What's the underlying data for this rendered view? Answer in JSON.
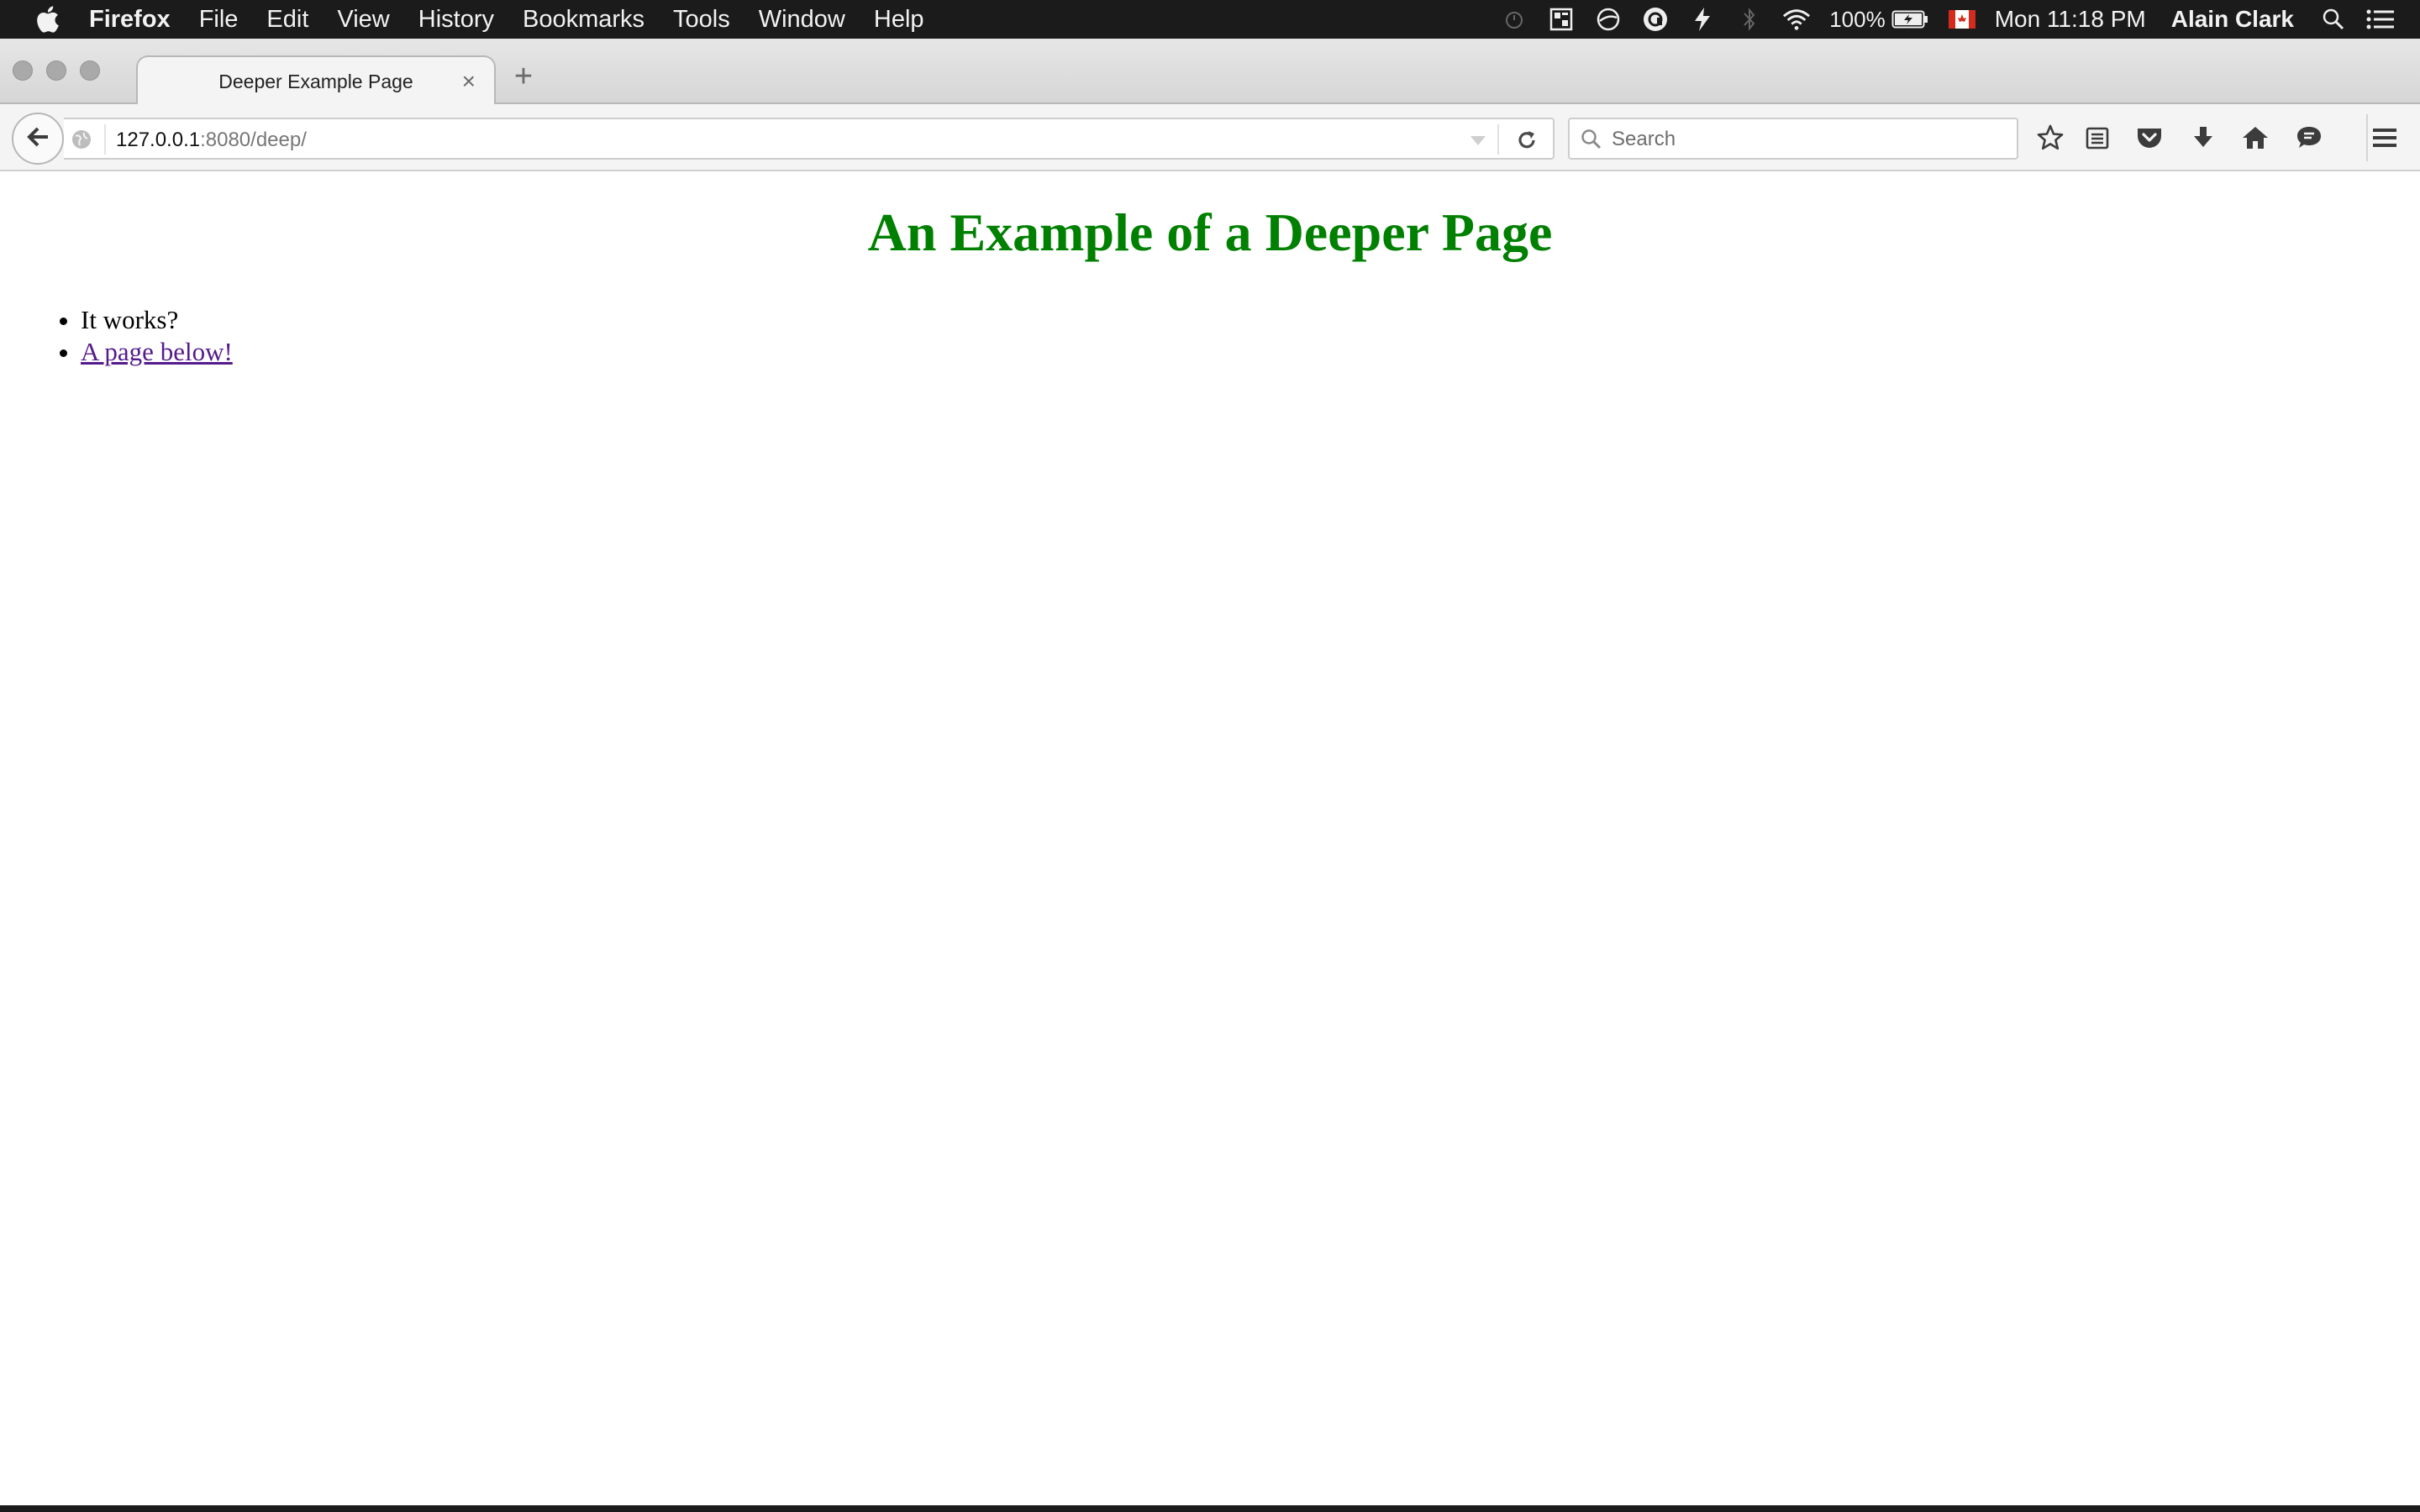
{
  "menubar": {
    "app_name": "Firefox",
    "items": [
      "File",
      "Edit",
      "View",
      "History",
      "Bookmarks",
      "Tools",
      "Window",
      "Help"
    ],
    "battery_percent": "100%",
    "clock": "Mon 11:18 PM",
    "user": "Alain Clark",
    "status_icons": [
      "timer-icon",
      "grid-app-icon",
      "circle-slash-icon",
      "grammarly-icon",
      "flash-app-icon",
      "bluetooth-icon",
      "wifi-icon",
      "battery-icon",
      "canada-flag-icon",
      "spotlight-search-icon",
      "notification-center-icon"
    ]
  },
  "tab": {
    "title": "Deeper Example Page"
  },
  "navbar": {
    "url_host": "127.0.0.1",
    "url_path": ":8080/deep/",
    "search_placeholder": "Search",
    "toolbar_icons": [
      "bookmark-star-icon",
      "reading-list-icon",
      "pocket-icon",
      "download-icon",
      "home-icon",
      "chat-icon",
      "hamburger-menu-icon"
    ]
  },
  "page": {
    "heading": "An Example of a Deeper Page",
    "heading_color": "#008000",
    "list": {
      "item1": "It works?",
      "item2_link": "A page below!"
    },
    "link_color": "#551a8b"
  }
}
